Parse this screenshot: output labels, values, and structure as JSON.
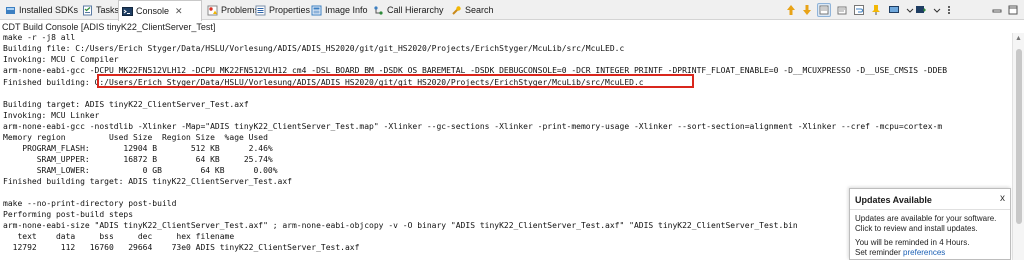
{
  "tabs": [
    {
      "label": "Installed SDKs",
      "icon": "sdk-icon",
      "active": false
    },
    {
      "label": "Tasks",
      "icon": "tasks-icon",
      "active": false
    },
    {
      "label": "Console",
      "icon": "console-icon",
      "active": true
    },
    {
      "label": "Problems",
      "icon": "problems-icon",
      "active": false
    },
    {
      "label": "Properties",
      "icon": "properties-icon",
      "active": false
    },
    {
      "label": "Image Info",
      "icon": "image-info-icon",
      "active": false
    },
    {
      "label": "Call Hierarchy",
      "icon": "call-hierarchy-icon",
      "active": false
    },
    {
      "label": "Search",
      "icon": "search-icon",
      "active": false
    }
  ],
  "tab_close_glyph": "✕",
  "toolbar_icons": [
    "scroll-up-icon",
    "scroll-down-icon",
    "clear-console-icon",
    "scroll-lock-icon",
    "word-wrap-icon",
    "pin-console-icon",
    "display-console-icon",
    "open-console-icon",
    "minimize-icon",
    "maximize-icon"
  ],
  "console": {
    "title": "CDT Build Console [ADIS tinyK22_ClientServer_Test]",
    "lines": [
      "make -r -j8 all",
      "Building file: C:/Users/Erich Styger/Data/HSLU/Vorlesung/ADIS/ADIS_HS2020/git/git_HS2020/Projects/ErichStyger/McuLib/src/McuLED.c",
      "Invoking: MCU C Compiler",
      "arm-none-eabi-gcc -DCPU_MK22FN512VLH12 -DCPU_MK22FN512VLH12_cm4 -DSL_BOARD_BM -DSDK_OS_BAREMETAL -DSDK_DEBUGCONSOLE=0 -DCR_INTEGER_PRINTF -DPRINTF_FLOAT_ENABLE=0 -D__MCUXPRESSO -D__USE_CMSIS -DDEB",
      "Finished building: C:/Users/Erich Styger/Data/HSLU/Vorlesung/ADIS/ADIS_HS2020/git/git_HS2020/Projects/ErichStyger/McuLib/src/McuLED.c",
      "",
      "Building target: ADIS tinyK22_ClientServer_Test.axf",
      "Invoking: MCU Linker",
      "arm-none-eabi-gcc -nostdlib -Xlinker -Map=\"ADIS tinyK22_ClientServer_Test.map\" -Xlinker --gc-sections -Xlinker -print-memory-usage -Xlinker --sort-section=alignment -Xlinker --cref -mcpu=cortex-m",
      "Memory region         Used Size  Region Size  %age Used",
      "    PROGRAM_FLASH:       12904 B       512 KB      2.46%",
      "       SRAM_UPPER:       16872 B        64 KB     25.74%",
      "       SRAM_LOWER:           0 GB        64 KB      0.00%",
      "Finished building target: ADIS tinyK22_ClientServer_Test.axf",
      "",
      "make --no-print-directory post-build",
      "Performing post-build steps",
      "arm-none-eabi-size \"ADIS tinyK22_ClientServer_Test.axf\" ; arm-none-eabi-objcopy -v -O binary \"ADIS tinyK22_ClientServer_Test.axf\" \"ADIS tinyK22_ClientServer_Test.bin",
      "   text    data     bss     dec     hex filename",
      "  12792     112   16760   29664    73e0 ADIS tinyK22_ClientServer_Test.axf"
    ]
  },
  "notification": {
    "title": "Updates Available",
    "close": "x",
    "line1": "Updates are available for your software.",
    "line2": "Click to review and install updates.",
    "line3": "You will be reminded in 4 Hours.",
    "line4_prefix": "Set reminder",
    "line4_link": "preferences"
  },
  "colors": {
    "highlight_border": "#d9261c",
    "link": "#1a5fb4"
  }
}
